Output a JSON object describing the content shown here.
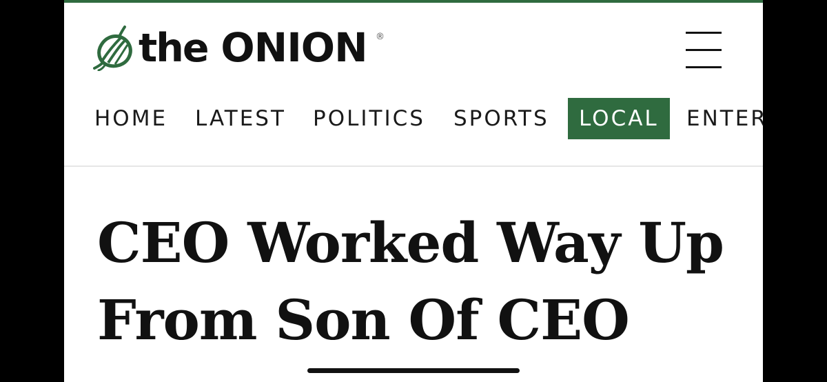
{
  "header": {
    "logo_the": "the",
    "logo_brand": "ONION",
    "registered_mark": "®",
    "logo_icon": "onion-icon",
    "menu_icon": "hamburger-menu-icon"
  },
  "nav": {
    "items": [
      {
        "label": "HOME",
        "active": false
      },
      {
        "label": "LATEST",
        "active": false
      },
      {
        "label": "POLITICS",
        "active": false
      },
      {
        "label": "SPORTS",
        "active": false
      },
      {
        "label": "LOCAL",
        "active": true
      },
      {
        "label": "ENTER",
        "active": false
      }
    ]
  },
  "article": {
    "headline": "CEO Worked Way Up From Son Of CEO"
  },
  "colors": {
    "brand_green": "#2f6b3f",
    "text": "#111111",
    "background": "#ffffff"
  }
}
